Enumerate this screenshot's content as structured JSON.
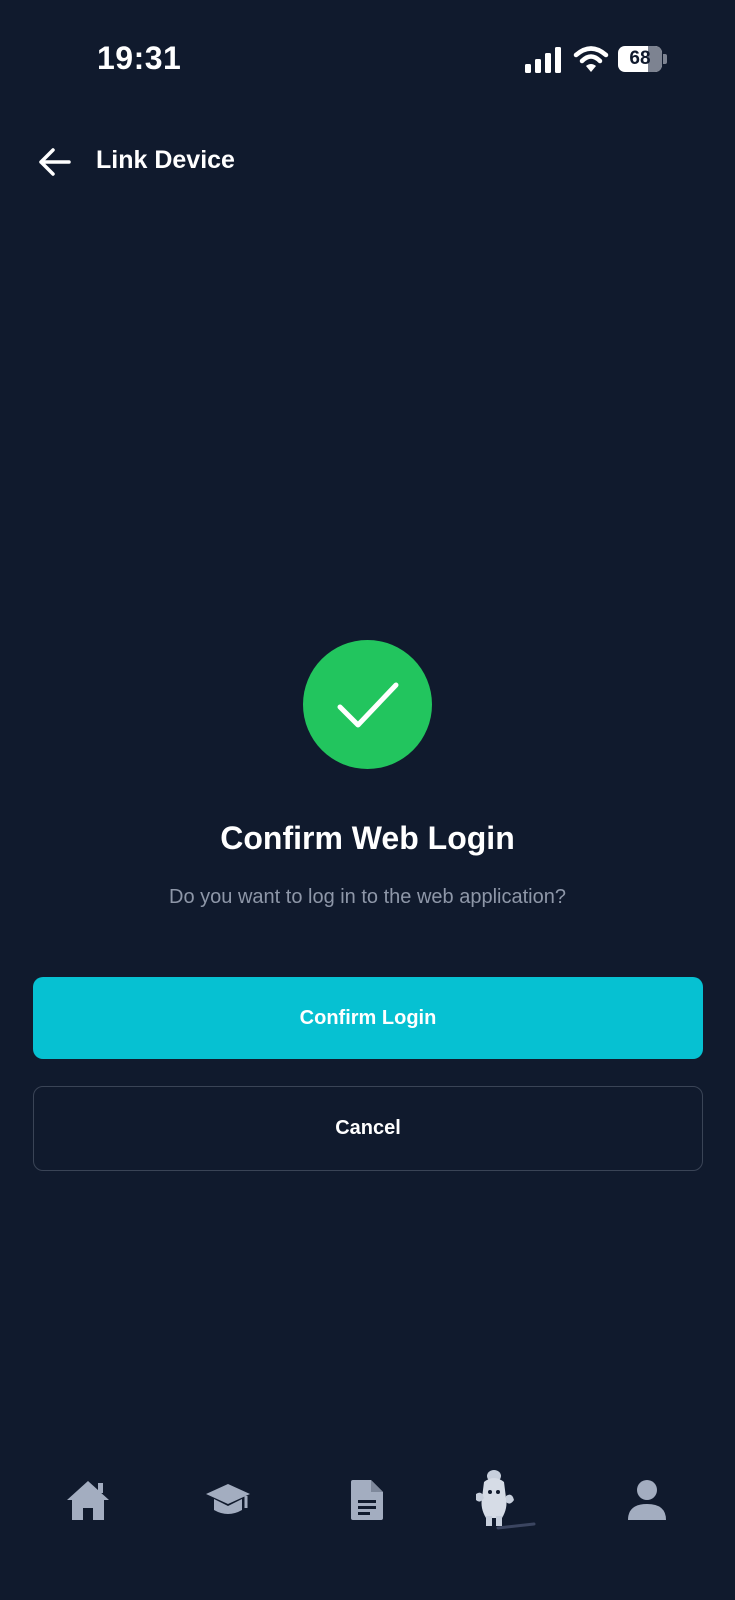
{
  "status_bar": {
    "time": "19:31",
    "battery_level": "68",
    "icons": [
      "signal-icon",
      "wifi-icon",
      "battery-icon"
    ]
  },
  "header": {
    "back_icon": "arrow-left-icon",
    "title": "Link Device"
  },
  "dialog": {
    "icon": "checkmark-icon",
    "title": "Confirm Web Login",
    "subtitle": "Do you want to log in to the web application?",
    "confirm_label": "Confirm Login",
    "cancel_label": "Cancel"
  },
  "bottom_nav": {
    "items": [
      {
        "icon": "home-icon"
      },
      {
        "icon": "graduation-cap-icon"
      },
      {
        "icon": "document-icon"
      },
      {
        "icon": "mascot-icon"
      },
      {
        "icon": "profile-icon"
      }
    ]
  },
  "colors": {
    "background": "#101a2d",
    "accent": "#06c1d2",
    "success": "#22c55e",
    "muted_text": "#8e97a8",
    "nav_icon": "#a3adc0"
  }
}
